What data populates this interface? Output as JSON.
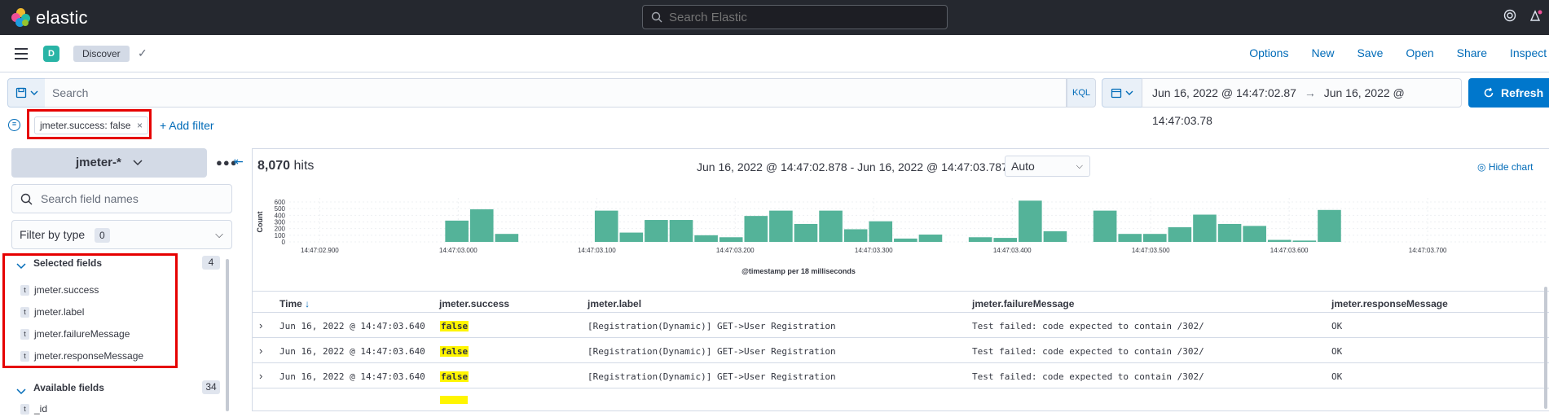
{
  "header": {
    "brand": "elastic",
    "global_search_placeholder": "Search Elastic"
  },
  "subbar": {
    "space_initial": "D",
    "app_name": "Discover",
    "menu": [
      "Options",
      "New",
      "Save",
      "Open",
      "Share",
      "Inspect"
    ]
  },
  "query": {
    "placeholder": "Search",
    "language": "KQL",
    "date_start": "Jun 16, 2022 @ 14:47:02.87",
    "date_end": "Jun 16, 2022 @ 14:47:03.78",
    "date_arrow": "→",
    "refresh_label": "Refresh"
  },
  "filters": {
    "pill_label": "jmeter.success: false",
    "add_filter_label": "+ Add filter"
  },
  "sidebar": {
    "index_pattern": "jmeter-*",
    "field_search_placeholder": "Search field names",
    "filter_by_type": "Filter by type",
    "filter_by_type_count": "0",
    "selected_label": "Selected fields",
    "selected_count": "4",
    "selected_fields": [
      {
        "type": "t",
        "name": "jmeter.success"
      },
      {
        "type": "t",
        "name": "jmeter.label"
      },
      {
        "type": "t",
        "name": "jmeter.failureMessage"
      },
      {
        "type": "t",
        "name": "jmeter.responseMessage"
      }
    ],
    "available_label": "Available fields",
    "available_count": "34",
    "available_fields": [
      {
        "type": "t",
        "name": "_id"
      }
    ]
  },
  "main": {
    "hits_count": "8,070",
    "hits_label": "hits",
    "range_text": "Jun 16, 2022 @ 14:47:02.878 - Jun 16, 2022 @ 14:47:03.787",
    "interval": "Auto",
    "hide_chart_label": "Hide chart"
  },
  "chart_data": {
    "type": "bar",
    "ylabel": "Count",
    "xlabel": "@timestamp per 18 milliseconds",
    "ylim": [
      0,
      600
    ],
    "y_ticks": [
      "0",
      "100",
      "200",
      "300",
      "400",
      "500",
      "600"
    ],
    "x_tick_labels": [
      "14:47:02.900",
      "14:47:03.000",
      "14:47:03.100",
      "14:47:03.200",
      "14:47:03.300",
      "14:47:03.400",
      "14:47:03.500",
      "14:47:03.600",
      "14:47:03.700"
    ],
    "x_tick_values": [
      900,
      1000,
      1100,
      1200,
      1300,
      1400,
      1500,
      1600,
      1700
    ],
    "x_range": [
      878,
      1787
    ],
    "bar_width_ms": 18,
    "bars": [
      {
        "t": 990,
        "count": 320
      },
      {
        "t": 1008,
        "count": 490
      },
      {
        "t": 1026,
        "count": 120
      },
      {
        "t": 1098,
        "count": 470
      },
      {
        "t": 1116,
        "count": 140
      },
      {
        "t": 1134,
        "count": 330
      },
      {
        "t": 1152,
        "count": 330
      },
      {
        "t": 1170,
        "count": 100
      },
      {
        "t": 1188,
        "count": 70
      },
      {
        "t": 1206,
        "count": 390
      },
      {
        "t": 1224,
        "count": 470
      },
      {
        "t": 1242,
        "count": 270
      },
      {
        "t": 1260,
        "count": 470
      },
      {
        "t": 1278,
        "count": 190
      },
      {
        "t": 1296,
        "count": 310
      },
      {
        "t": 1314,
        "count": 50
      },
      {
        "t": 1332,
        "count": 110
      },
      {
        "t": 1368,
        "count": 70
      },
      {
        "t": 1386,
        "count": 60
      },
      {
        "t": 1404,
        "count": 620
      },
      {
        "t": 1422,
        "count": 160
      },
      {
        "t": 1458,
        "count": 470
      },
      {
        "t": 1476,
        "count": 120
      },
      {
        "t": 1494,
        "count": 120
      },
      {
        "t": 1512,
        "count": 220
      },
      {
        "t": 1530,
        "count": 410
      },
      {
        "t": 1548,
        "count": 270
      },
      {
        "t": 1566,
        "count": 240
      },
      {
        "t": 1584,
        "count": 30
      },
      {
        "t": 1602,
        "count": 20
      },
      {
        "t": 1620,
        "count": 480
      }
    ],
    "bar_color": "#54b399"
  },
  "table": {
    "columns": [
      "Time",
      "jmeter.success",
      "jmeter.label",
      "jmeter.failureMessage",
      "jmeter.responseMessage"
    ],
    "sort_indicator": "↓",
    "rows": [
      {
        "time": "Jun 16, 2022 @ 14:47:03.640",
        "success": "false",
        "label": "[Registration(Dynamic)] GET->User Registration",
        "failure": "Test failed: code expected to contain /302/",
        "response": "OK"
      },
      {
        "time": "Jun 16, 2022 @ 14:47:03.640",
        "success": "false",
        "label": "[Registration(Dynamic)] GET->User Registration",
        "failure": "Test failed: code expected to contain /302/",
        "response": "OK"
      },
      {
        "time": "Jun 16, 2022 @ 14:47:03.640",
        "success": "false",
        "label": "[Registration(Dynamic)] GET->User Registration",
        "failure": "Test failed: code expected to contain /302/",
        "response": "OK"
      }
    ]
  },
  "colors": {
    "accent": "#006bb8",
    "refresh_bg": "#0077cc",
    "highlight_box": "#e60000",
    "highlight_text": "#fff500"
  }
}
